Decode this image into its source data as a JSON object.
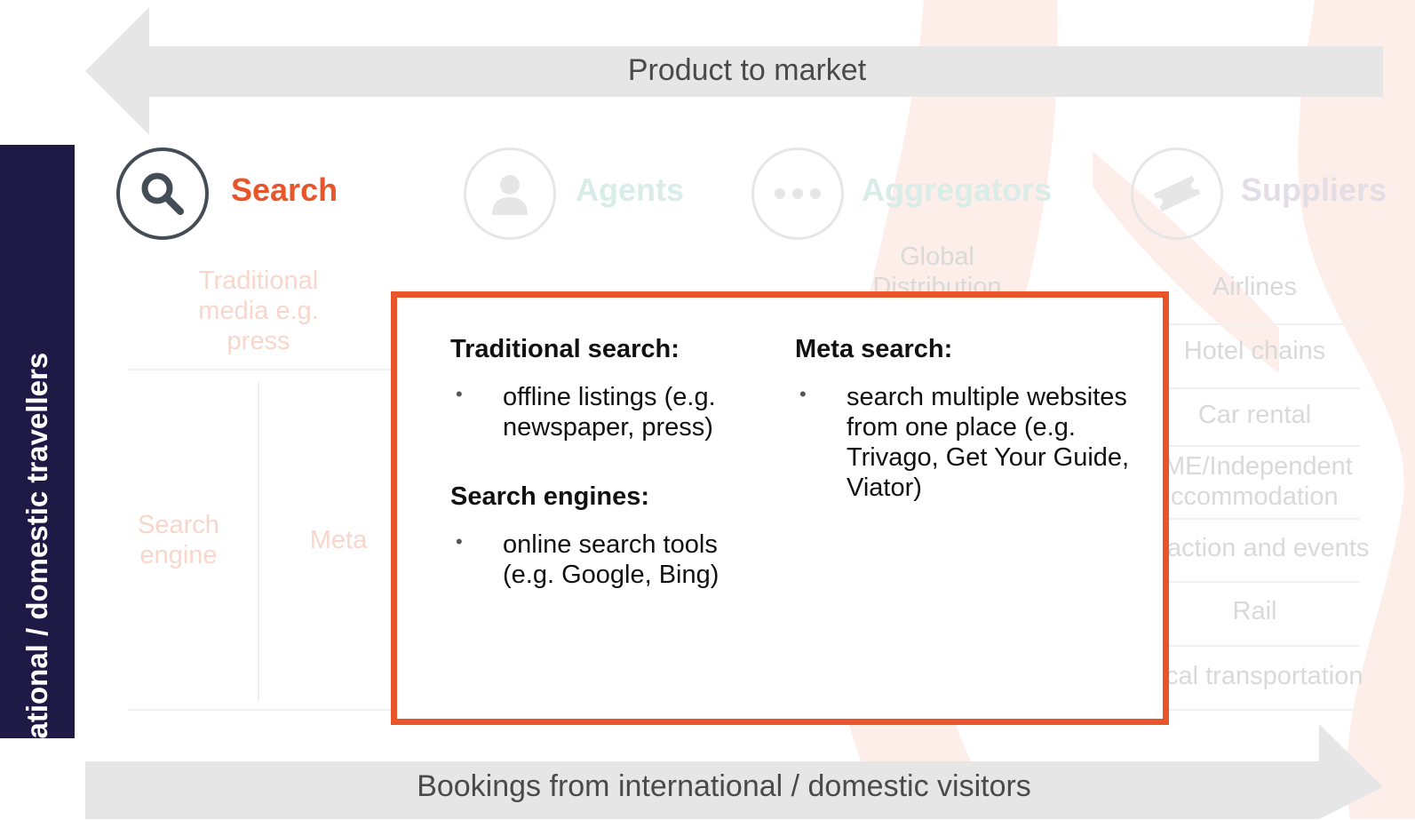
{
  "arrows": {
    "top_label": "Product to market",
    "bottom_label": "Bookings from international / domestic visitors"
  },
  "side_bar": {
    "label": "International /  domestic travellers"
  },
  "categories": [
    {
      "name": "search",
      "label": "Search",
      "icon": "search-icon",
      "color": "#e8552b",
      "active": true
    },
    {
      "name": "agents",
      "label": "Agents",
      "icon": "person-icon",
      "color": "#d8ece8",
      "active": false
    },
    {
      "name": "aggregators",
      "label": "Aggregators",
      "icon": "ellipsis-icon",
      "color": "#d8ece8",
      "active": false
    },
    {
      "name": "suppliers",
      "label": "Suppliers",
      "icon": "ticket-icon",
      "color": "#e3dde6",
      "active": false
    }
  ],
  "search_column": {
    "traditional_media": "Traditional media e.g. press",
    "search_engine": "Search engine",
    "meta": "Meta"
  },
  "aggregators_column": {
    "gds": "Global Distribution"
  },
  "suppliers_list": [
    "Airlines",
    "Hotel chains",
    "Car rental",
    "ME/Independent",
    "ccommodation",
    "action and events",
    "Rail",
    "cal transportation"
  ],
  "popup": {
    "traditional_title": "Traditional search:",
    "traditional_bullet": "offline listings (e.g. newspaper, press)",
    "engines_title": "Search engines:",
    "engines_bullet": "online search tools (e.g. Google, Bing)",
    "meta_title": "Meta search:",
    "meta_bullet": "search multiple websites from one place (e.g. Trivago, Get Your Guide, Viator)",
    "bullet_char": "•"
  },
  "colors": {
    "accent": "#e8552b",
    "navy": "#1f1a45",
    "arrow_gray": "#e6e6e6",
    "swoosh": "#fdeeea"
  }
}
